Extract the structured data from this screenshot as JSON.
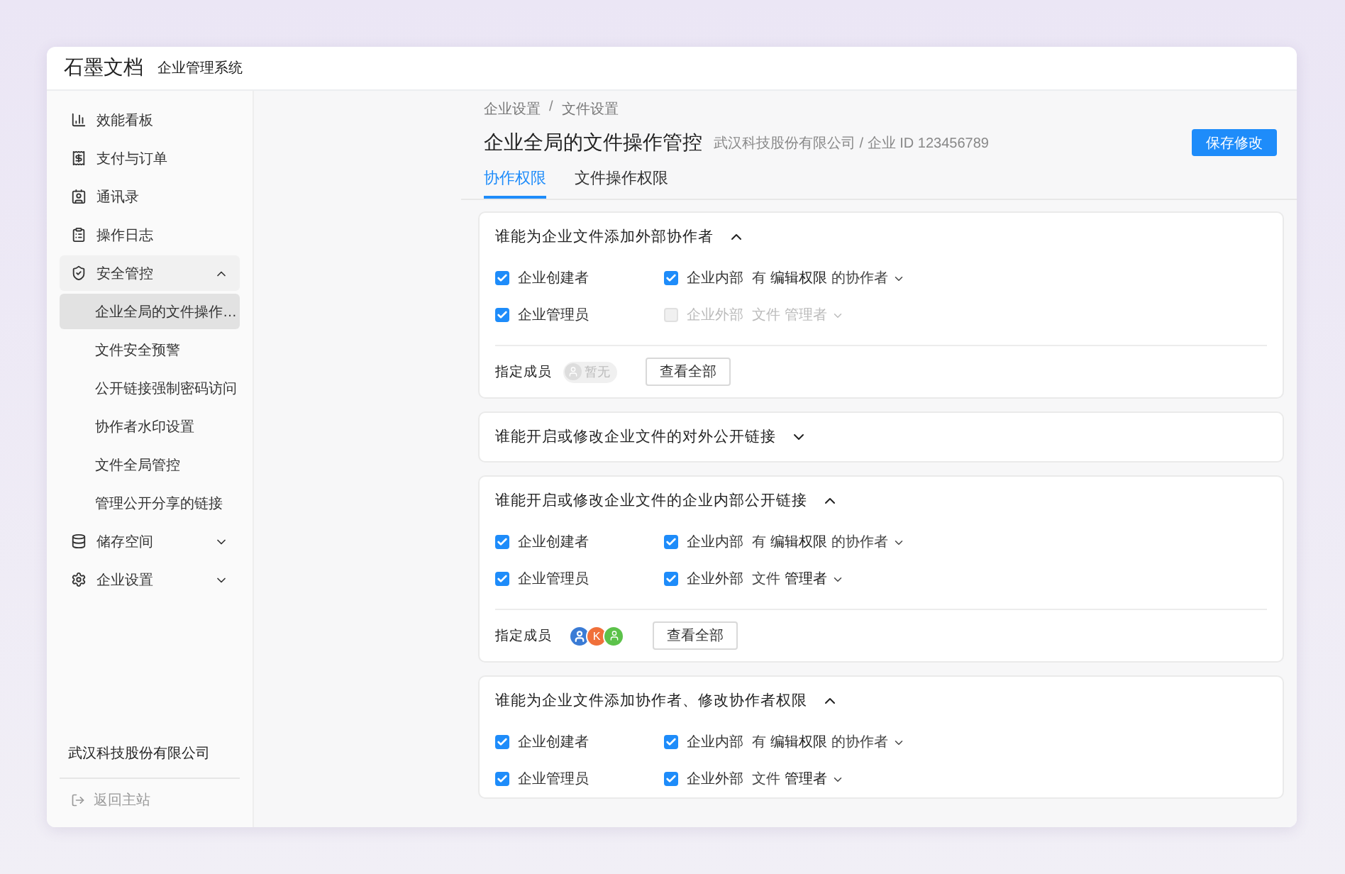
{
  "header": {
    "logo": "石墨文档",
    "product": "企业管理系统"
  },
  "sidebar": {
    "items": [
      {
        "label": "效能看板",
        "selected": false
      },
      {
        "label": "支付与订单",
        "selected": false
      },
      {
        "label": "通讯录",
        "selected": false
      },
      {
        "label": "操作日志",
        "selected": false
      },
      {
        "label": "安全管控",
        "selected": false,
        "expanded": true,
        "children": [
          {
            "label": "企业全局的文件操作…",
            "selected": true
          },
          {
            "label": "文件安全预警",
            "selected": false
          },
          {
            "label": "公开链接强制密码访问",
            "selected": false
          },
          {
            "label": "协作者水印设置",
            "selected": false
          },
          {
            "label": "文件全局管控",
            "selected": false
          },
          {
            "label": "管理公开分享的链接",
            "selected": false
          }
        ]
      },
      {
        "label": "储存空间",
        "selected": false,
        "expanded": false
      },
      {
        "label": "企业设置",
        "selected": false,
        "expanded": false
      }
    ],
    "company": "武汉科技股份有限公司",
    "back_link": "返回主站"
  },
  "breadcrumb": {
    "items": [
      "企业设置",
      "文件设置"
    ],
    "separator": "/"
  },
  "title": "企业全局的文件操作管控",
  "subtitle": "武汉科技股份有限公司 / 企业 ID 123456789",
  "save_button": "保存修改",
  "tabs": [
    {
      "label": "协作权限",
      "selected": true
    },
    {
      "label": "文件操作权限",
      "selected": false
    }
  ],
  "sections": [
    {
      "title": "谁能为企业文件添加外部协作者",
      "expanded": true,
      "rows": [
        {
          "left": {
            "label": "企业创建者",
            "checked": true,
            "disabled": false
          },
          "right": {
            "label": "企业内部",
            "checked": true,
            "disabled": false,
            "prefix": "有",
            "value": "编辑权限",
            "suffix": "的协作者"
          }
        },
        {
          "left": {
            "label": "企业管理员",
            "checked": true,
            "disabled": false
          },
          "right": {
            "label": "企业外部",
            "checked": false,
            "disabled": true,
            "prefix": "文件",
            "value": "管理者"
          }
        }
      ],
      "members": {
        "label": "指定成员",
        "empty_text": "暂无",
        "view_all": "查看全部"
      }
    },
    {
      "title": "谁能开启或修改企业文件的对外公开链接",
      "expanded": false
    },
    {
      "title": "谁能开启或修改企业文件的企业内部公开链接",
      "expanded": true,
      "rows": [
        {
          "left": {
            "label": "企业创建者",
            "checked": true,
            "disabled": false
          },
          "right": {
            "label": "企业内部",
            "checked": true,
            "disabled": false,
            "prefix": "有",
            "value": "编辑权限",
            "suffix": "的协作者"
          }
        },
        {
          "left": {
            "label": "企业管理员",
            "checked": true,
            "disabled": false
          },
          "right": {
            "label": "企业外部",
            "checked": true,
            "disabled": false,
            "prefix": "文件",
            "value": "管理者"
          }
        }
      ],
      "members": {
        "label": "指定成员",
        "avatars": [
          {
            "kind": "photo",
            "color": "#3a7bd5"
          },
          {
            "kind": "letter",
            "text": "K",
            "color": "#f0703a"
          },
          {
            "kind": "person",
            "color": "#5cc24a"
          }
        ],
        "view_all": "查看全部"
      }
    },
    {
      "title": "谁能为企业文件添加协作者、修改协作者权限",
      "expanded": true,
      "rows": [
        {
          "left": {
            "label": "企业创建者",
            "checked": true,
            "disabled": false
          },
          "right": {
            "label": "企业内部",
            "checked": true,
            "disabled": false,
            "prefix": "有",
            "value": "编辑权限",
            "suffix": "的协作者"
          }
        },
        {
          "left": {
            "label": "企业管理员",
            "checked": true,
            "disabled": false
          },
          "right": {
            "label": "企业外部",
            "checked": true,
            "disabled": false,
            "prefix": "文件",
            "value": "管理者"
          }
        }
      ]
    }
  ]
}
